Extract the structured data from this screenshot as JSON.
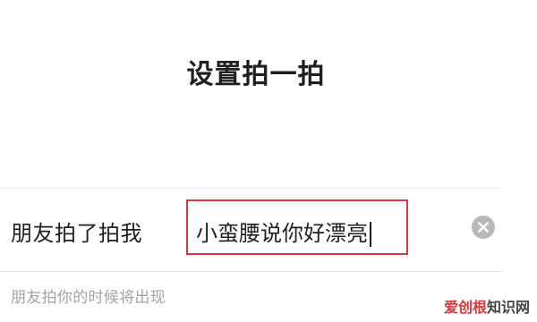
{
  "header": {
    "title": "设置拍一拍"
  },
  "form": {
    "label": "朋友拍了拍我",
    "input_value": "小蛮腰说你好漂亮",
    "clear_icon": "clear-circle-icon",
    "hint": "朋友拍你的时候将出现"
  },
  "watermark": {
    "part1": "爱创根",
    "part2": "知识网"
  },
  "colors": {
    "highlight_border": "#d9363e",
    "hint_text": "#a3a3a3",
    "clear_icon_bg": "#b9b9b9"
  }
}
